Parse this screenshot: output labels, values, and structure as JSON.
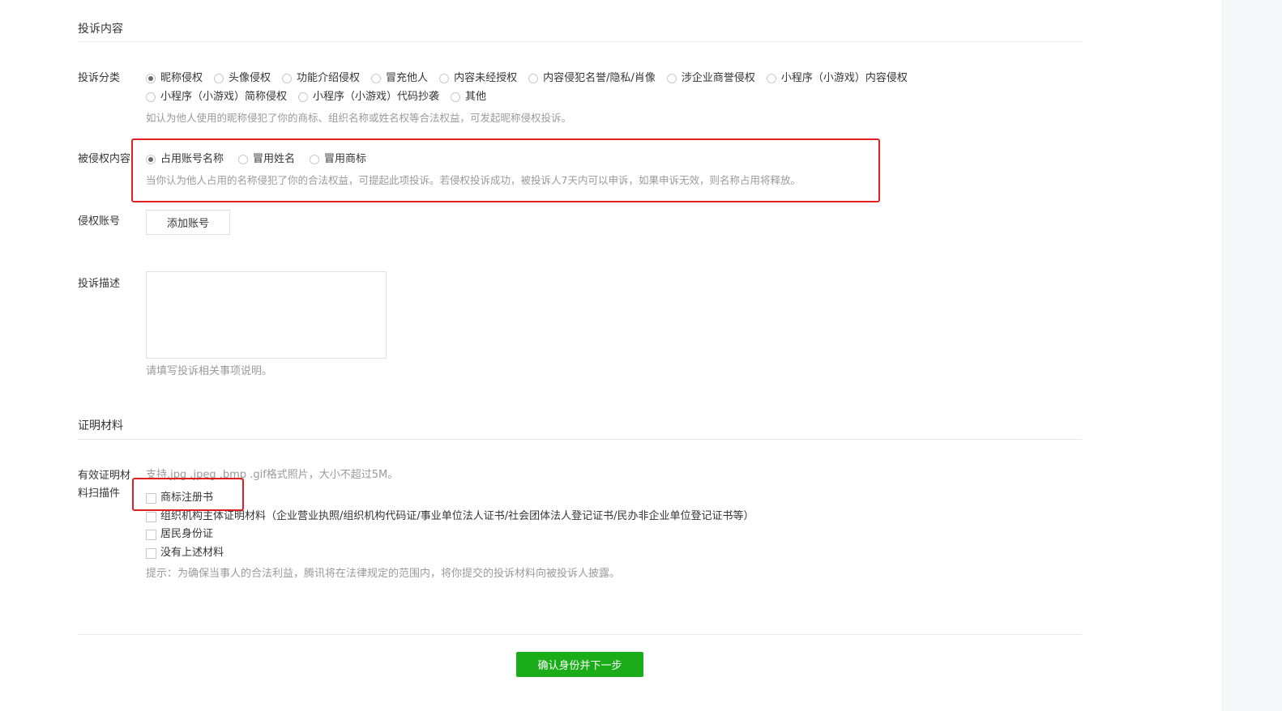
{
  "section_complaint": {
    "title": "投诉内容"
  },
  "category": {
    "label": "投诉分类",
    "options_row1": [
      {
        "label": "昵称侵权",
        "checked": true
      },
      {
        "label": "头像侵权",
        "checked": false
      },
      {
        "label": "功能介绍侵权",
        "checked": false
      },
      {
        "label": "冒充他人",
        "checked": false
      },
      {
        "label": "内容未经授权",
        "checked": false
      },
      {
        "label": "内容侵犯名誉/隐私/肖像",
        "checked": false
      },
      {
        "label": "涉企业商誉侵权",
        "checked": false
      },
      {
        "label": "小程序（小游戏）内容侵权",
        "checked": false
      }
    ],
    "options_row2": [
      {
        "label": "小程序（小游戏）简称侵权",
        "checked": false
      },
      {
        "label": "小程序（小游戏）代码抄袭",
        "checked": false
      },
      {
        "label": "其他",
        "checked": false
      }
    ],
    "hint": "如认为他人使用的昵称侵犯了你的商标、组织名称或姓名权等合法权益，可发起昵称侵权投诉。"
  },
  "infringed": {
    "label": "被侵权内容",
    "options": [
      {
        "label": "占用账号名称",
        "checked": true
      },
      {
        "label": "冒用姓名",
        "checked": false
      },
      {
        "label": "冒用商标",
        "checked": false
      }
    ],
    "hint": "当你认为他人占用的名称侵犯了你的合法权益，可提起此项投诉。若侵权投诉成功，被投诉人7天内可以申诉，如果申诉无效，则名称占用将释放。"
  },
  "account": {
    "label": "侵权账号",
    "add_button": "添加账号"
  },
  "description": {
    "label": "投诉描述",
    "value": "",
    "hint": "请填写投诉相关事项说明。"
  },
  "section_proof": {
    "title": "证明材料"
  },
  "proof": {
    "label": "有效证明材料扫描件",
    "upload_hint": "支持.jpg .jpeg .bmp .gif格式照片，大小不超过5M。",
    "items": [
      {
        "label": "商标注册书",
        "checked": false
      },
      {
        "label": "组织机构主体证明材料（企业营业执照/组织机构代码证/事业单位法人证书/社会团体法人登记证书/民办非企业单位登记证书等）",
        "checked": false
      },
      {
        "label": "居民身份证",
        "checked": false
      },
      {
        "label": "没有上述材料",
        "checked": false
      }
    ],
    "tip": "提示：为确保当事人的合法利益，腾讯将在法律规定的范围内，将你提交的投诉材料向被投诉人披露。"
  },
  "footer": {
    "next_button": "确认身份并下一步"
  },
  "colors": {
    "primary_button": "#1aad19",
    "highlight_box": "#e02020",
    "hint_text": "#9a9a9a"
  }
}
